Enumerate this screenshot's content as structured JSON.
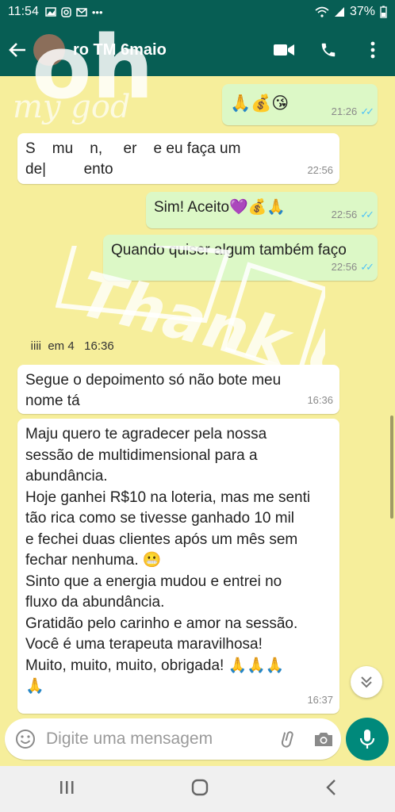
{
  "status": {
    "time": "11:54",
    "battery": "37%"
  },
  "header": {
    "title": "ro TM 6maio"
  },
  "watermarks": {
    "oh": "oh",
    "mygod": "my god",
    "thank": "Thank U"
  },
  "messages": [
    {
      "dir": "out",
      "text": "🙏💰😘",
      "time": "21:26",
      "read": true
    },
    {
      "dir": "in",
      "text": "S    mu    n,     er    e eu faça um\nde|         ento",
      "time": "22:56"
    },
    {
      "dir": "out",
      "text": "Sim! Aceito💜💰🙏",
      "time": "22:56",
      "read": true
    },
    {
      "dir": "out",
      "text": "Quando quiser algum também faço",
      "time": "22:56",
      "read": true
    },
    {
      "dir": "in",
      "text": "Segue o depoimento só não bote meu\nnome tá",
      "time": "16:36"
    },
    {
      "dir": "in",
      "text": "Maju quero te agradecer pela nossa\nsessão de multidimensional para a\nabundância.\nHoje ganhei R$10 na loteria, mas me senti\ntão rica como se tivesse ganhado 10 mil\ne fechei duas clientes após um mês sem\nfechar nenhuma. 😬\nSinto que a energia mudou e entrei no\nfluxo da abundância.\nGratidão pelo carinho e amor na sessão.\nVocê é uma terapeuta maravilhosa!\nMuito, muito, muito, obrigada! 🙏🙏🙏\n🙏",
      "time": "16:37"
    }
  ],
  "forwarded_label": "    iiii  em 4   16:36",
  "input": {
    "placeholder": "Digite uma mensagem"
  },
  "colors": {
    "header": "#075e54",
    "chat_background": "#f6ee9b",
    "outgoing": "#dcf8c6",
    "incoming": "#ffffff",
    "accent": "#00897b"
  }
}
